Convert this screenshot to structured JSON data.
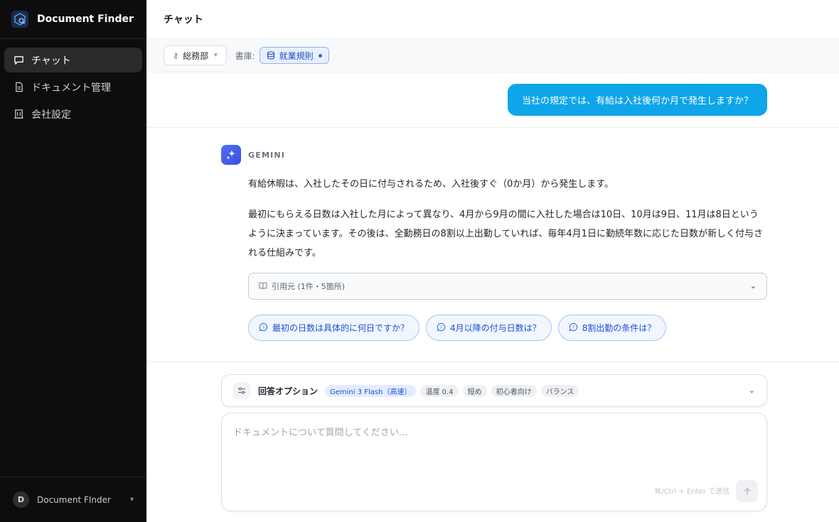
{
  "app": {
    "title": "Document Finder"
  },
  "sidebar": {
    "items": [
      {
        "label": "チャット",
        "icon": "chat-icon",
        "active": true
      },
      {
        "label": "ドキュメント管理",
        "icon": "document-icon",
        "active": false
      },
      {
        "label": "会社設定",
        "icon": "building-icon",
        "active": false
      }
    ],
    "footer": {
      "avatar_initial": "D",
      "name": "Document FInder"
    }
  },
  "header": {
    "title": "チャット"
  },
  "filters": {
    "department": "総務部",
    "library_label": "書庫:",
    "library_chip": "就業規則"
  },
  "conversation": {
    "user_message": "当社の規定では、有給は入社後何か月で発生しますか？",
    "assistant": {
      "name": "GEMINI",
      "paragraphs": [
        "有給休暇は、入社したその日に付与されるため、入社後すぐ（0か月）から発生します。",
        "最初にもらえる日数は入社した月によって異なり、4月から9月の間に入社した場合は10日、10月は9日、11月は8日というように決まっています。その後は、全勤務日の8割以上出勤していれば、毎年4月1日に勤続年数に応じた日数が新しく付与される仕組みです。"
      ],
      "citation_label": "引用元 (1件・5箇所)",
      "suggestions": [
        "最初の日数は具体的に何日ですか？",
        "4月以降の付与日数は？",
        "8割出勤の条件は？"
      ]
    }
  },
  "options": {
    "title": "回答オプション",
    "model": "Gemini 3 Flash（高速）",
    "tags": [
      "温度 0.4",
      "短め",
      "初心者向け",
      "バランス"
    ]
  },
  "composer": {
    "placeholder": "ドキュメントについて質問してください...",
    "hint": "⌘/Ctrl + Enter で送信"
  },
  "colors": {
    "sidebar_bg": "#0d0d0d",
    "user_bubble": "#0ea5e9",
    "accent": "#1d4ed8"
  }
}
